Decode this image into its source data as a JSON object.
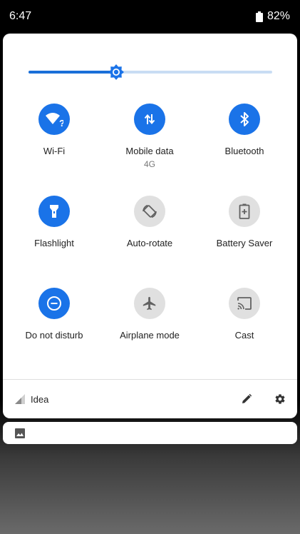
{
  "status_bar": {
    "time": "6:47",
    "battery": "82%"
  },
  "brightness": {
    "level": 0.36
  },
  "tiles": [
    {
      "label": "Wi-Fi",
      "sub": "",
      "icon": "wifi-question-icon",
      "state": "on"
    },
    {
      "label": "Mobile data",
      "sub": "4G",
      "icon": "mobile-data-arrows-icon",
      "state": "on"
    },
    {
      "label": "Bluetooth",
      "sub": "",
      "icon": "bluetooth-icon",
      "state": "on"
    },
    {
      "label": "Flashlight",
      "sub": "",
      "icon": "flashlight-icon",
      "state": "on"
    },
    {
      "label": "Auto-rotate",
      "sub": "",
      "icon": "auto-rotate-icon",
      "state": "off"
    },
    {
      "label": "Battery Saver",
      "sub": "",
      "icon": "battery-saver-icon",
      "state": "off"
    },
    {
      "label": "Do not disturb",
      "sub": "",
      "icon": "do-not-disturb-icon",
      "state": "on"
    },
    {
      "label": "Airplane mode",
      "sub": "",
      "icon": "airplane-icon",
      "state": "off"
    },
    {
      "label": "Cast",
      "sub": "",
      "icon": "cast-icon",
      "state": "off"
    }
  ],
  "footer": {
    "carrier": "Idea"
  },
  "colors": {
    "accent": "#1a73e8",
    "tile_off": "#e0e0e0",
    "track": "#c9ddf4"
  }
}
